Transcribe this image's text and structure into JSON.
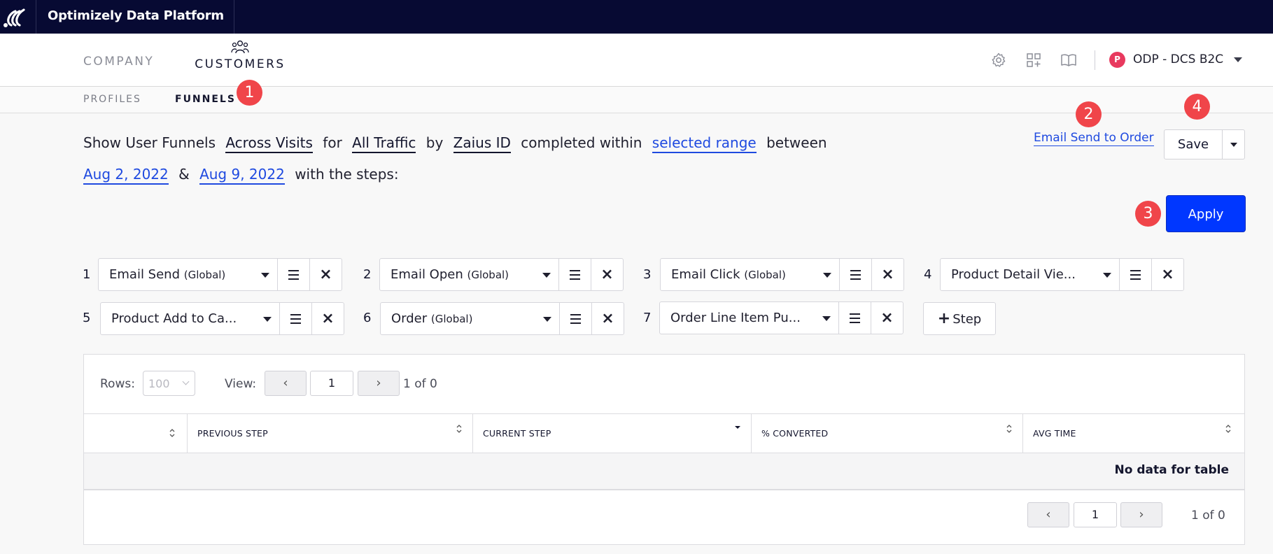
{
  "app": {
    "title": "Optimizely Data Platform"
  },
  "nav": {
    "company": "COMPANY",
    "customers": "CUSTOMERS"
  },
  "account": {
    "badge": "P",
    "name": "ODP - DCS B2C"
  },
  "subnav": {
    "profiles": "PROFILES",
    "funnels": "FUNNELS"
  },
  "markers": [
    "1",
    "2",
    "3",
    "4"
  ],
  "sentence": {
    "show": "Show User Funnels",
    "mode": "Across Visits",
    "for": "for",
    "traffic": "All Traffic",
    "by": "by",
    "id": "Zaius ID",
    "completed": "completed within",
    "range": "selected range",
    "between": "between",
    "start_date": "Aug 2, 2022",
    "amp": "&",
    "end_date": "Aug 9, 2022",
    "with": "with the steps:"
  },
  "saved_funnel": "Email Send to Order",
  "buttons": {
    "save": "Save",
    "apply": "Apply",
    "add_step": "Step"
  },
  "steps": [
    {
      "num": "1",
      "label": "Email Send",
      "scope": "(Global)"
    },
    {
      "num": "2",
      "label": "Email Open",
      "scope": "(Global)"
    },
    {
      "num": "3",
      "label": "Email Click",
      "scope": "(Global)"
    },
    {
      "num": "4",
      "label": "Product Detail Vie...",
      "scope": ""
    },
    {
      "num": "5",
      "label": "Product Add to Ca...",
      "scope": ""
    },
    {
      "num": "6",
      "label": "Order",
      "scope": "(Global)"
    },
    {
      "num": "7",
      "label": "Order Line Item Pu...",
      "scope": ""
    }
  ],
  "table": {
    "rows_label": "Rows:",
    "rows_value": "100",
    "view_label": "View:",
    "page": "1",
    "page_of": "1 of 0",
    "columns": [
      "",
      "PREVIOUS STEP",
      "CURRENT STEP",
      "% CONVERTED",
      "AVG TIME"
    ],
    "empty_message": "No data for table"
  },
  "colors": {
    "topbar": "#070a33",
    "accent": "#0037ff",
    "link": "#1f4ae0",
    "marker": "#f0454a",
    "badge": "#e8395e"
  }
}
